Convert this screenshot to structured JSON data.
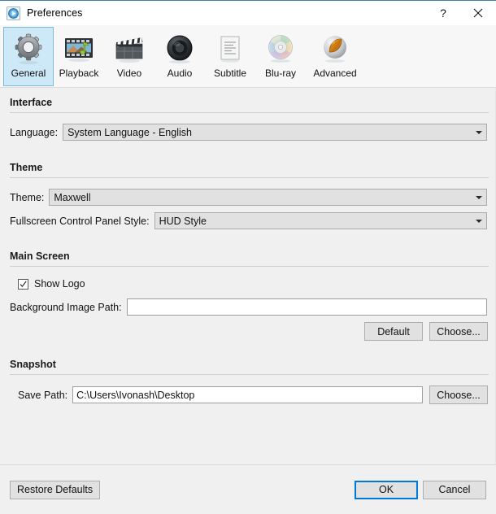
{
  "window": {
    "title": "Preferences",
    "app_icon": "media-player-icon",
    "help_label": "?",
    "close_label": "close-icon",
    "accent_color": "#0078d7",
    "title_accent_line": "#3a7fb1"
  },
  "toolbar": {
    "tabs": [
      {
        "label": "General",
        "icon": "gear-icon",
        "selected": true
      },
      {
        "label": "Playback",
        "icon": "filmstrip-music-icon",
        "selected": false
      },
      {
        "label": "Video",
        "icon": "clapperboard-icon",
        "selected": false
      },
      {
        "label": "Audio",
        "icon": "speaker-icon",
        "selected": false
      },
      {
        "label": "Subtitle",
        "icon": "document-lines-icon",
        "selected": false
      },
      {
        "label": "Blu-ray",
        "icon": "disc-icon",
        "selected": false
      },
      {
        "label": "Advanced",
        "icon": "leaf-sphere-icon",
        "selected": false
      }
    ]
  },
  "sections": {
    "interface": {
      "title": "Interface",
      "language_label": "Language:",
      "language_value": "System Language - English"
    },
    "theme": {
      "title": "Theme",
      "theme_label": "Theme:",
      "theme_value": "Maxwell",
      "fullscreen_label": "Fullscreen Control Panel Style:",
      "fullscreen_value": "HUD Style"
    },
    "main_screen": {
      "title": "Main Screen",
      "show_logo_label": "Show Logo",
      "show_logo_checked": true,
      "bg_path_label": "Background Image Path:",
      "bg_path_value": "",
      "bg_path_placeholder": "",
      "default_button": "Default",
      "choose_button": "Choose..."
    },
    "snapshot": {
      "title": "Snapshot",
      "save_path_label": "Save Path:",
      "save_path_value": "C:\\Users\\Ivonash\\Desktop",
      "choose_button": "Choose..."
    }
  },
  "footer": {
    "restore_defaults": "Restore Defaults",
    "ok": "OK",
    "cancel": "Cancel"
  }
}
